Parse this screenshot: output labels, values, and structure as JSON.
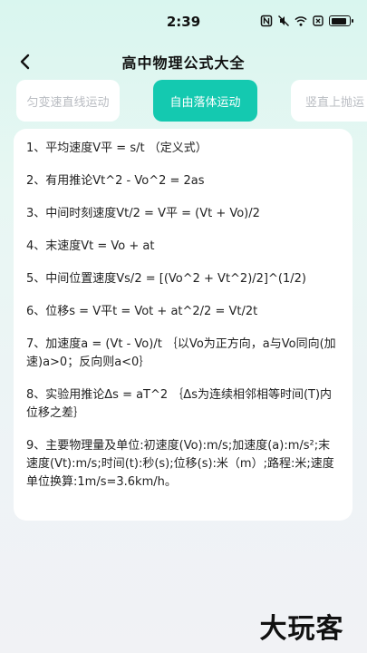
{
  "status": {
    "time": "2:39"
  },
  "header": {
    "title": "高中物理公式大全"
  },
  "tabs": [
    {
      "label": "匀变速直线运动",
      "active": false
    },
    {
      "label": "自由落体运动",
      "active": true
    },
    {
      "label": "竖直上抛运",
      "active": false
    }
  ],
  "formulas": [
    "1、平均速度V平 = s/t （定义式）",
    "2、有用推论Vt^2 - Vo^2 = 2as",
    "3、中间时刻速度Vt/2 = V平 = (Vt + Vo)/2",
    "4、末速度Vt = Vo + at",
    "5、中间位置速度Vs/2 = [(Vo^2 + Vt^2)/2]^(1/2)",
    "6、位移s = V平t = Vot + at^2/2 = Vt/2t",
    "7、加速度a = (Vt - Vo)/t ｛以Vo为正方向，a与Vo同向(加速)a>0；反向则a<0｝",
    "8、实验用推论Δs = aT^2 ｛Δs为连续相邻相等时间(T)内位移之差｝",
    "9、主要物理量及单位:初速度(Vo):m/s;加速度(a):m/s²;末速度(Vt):m/s;时间(t):秒(s);位移(s):米（m）;路程:米;速度单位换算:1m/s=3.6km/h。"
  ],
  "watermark": {
    "text": "大玩客"
  },
  "colors": {
    "accent": "#14c9b0",
    "tab_inactive_text": "#b9bcc2"
  }
}
